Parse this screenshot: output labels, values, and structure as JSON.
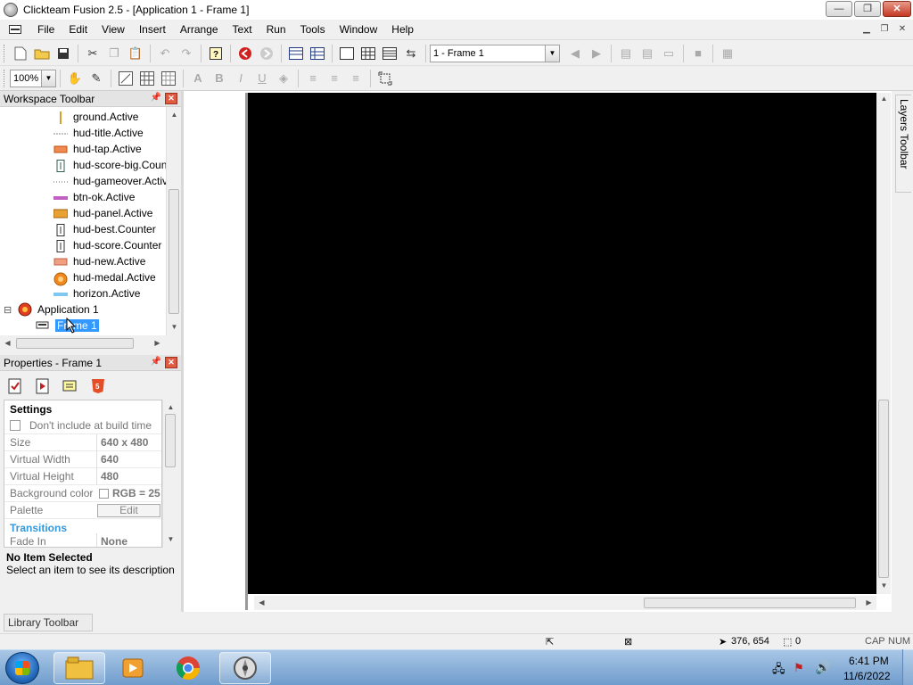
{
  "window": {
    "title": "Clickteam Fusion 2.5 - [Application 1 - Frame 1]",
    "minimize": "—",
    "restore": "❐",
    "close": "✕"
  },
  "menu": [
    "File",
    "Edit",
    "View",
    "Insert",
    "Arrange",
    "Text",
    "Run",
    "Tools",
    "Window",
    "Help"
  ],
  "toolbar": {
    "frame_select": "1 - Frame 1",
    "zoom": "100%",
    "bold": "B",
    "italic": "I",
    "underline": "U"
  },
  "workspace": {
    "title": "Workspace Toolbar",
    "objects": [
      {
        "label": "ground.Active",
        "icon": "ground-icon"
      },
      {
        "label": "hud-title.Active",
        "icon": "hud-title-icon"
      },
      {
        "label": "hud-tap.Active",
        "icon": "hud-tap-icon"
      },
      {
        "label": "hud-score-big.Counter",
        "icon": "counter-icon"
      },
      {
        "label": "hud-gameover.Active",
        "icon": "hud-gameover-icon"
      },
      {
        "label": "btn-ok.Active",
        "icon": "btn-ok-icon"
      },
      {
        "label": "hud-panel.Active",
        "icon": "hud-panel-icon"
      },
      {
        "label": "hud-best.Counter",
        "icon": "counter-icon"
      },
      {
        "label": "hud-score.Counter",
        "icon": "counter-icon"
      },
      {
        "label": "hud-new.Active",
        "icon": "hud-new-icon"
      },
      {
        "label": "hud-medal.Active",
        "icon": "hud-medal-icon"
      },
      {
        "label": "horizon.Active",
        "icon": "horizon-icon"
      }
    ],
    "application": "Application 1",
    "frame": "Frame 1",
    "expand_symbol": "⊟"
  },
  "properties": {
    "title": "Properties - Frame 1",
    "section": "Settings",
    "build_checkbox_label": "Don't include at build time",
    "rows": [
      {
        "name": "Size",
        "value": "640 x 480"
      },
      {
        "name": "Virtual Width",
        "value": "640"
      },
      {
        "name": "Virtual Height",
        "value": "480"
      },
      {
        "name": "Background color",
        "value": "RGB = 25"
      },
      {
        "name": "Palette",
        "value": "Edit"
      }
    ],
    "transitions_header": "Transitions",
    "fade_in": {
      "name": "Fade In",
      "value": "None"
    },
    "desc_title": "No Item Selected",
    "desc_text": "Select an item to see its description"
  },
  "layers_tab": "Layers Toolbar",
  "library_tab": "Library Toolbar",
  "status": {
    "coords": "376, 654",
    "count": "0",
    "cap": "CAP",
    "num": "NUM"
  },
  "taskbar": {
    "time": "6:41 PM",
    "date": "11/6/2022"
  },
  "colors": {
    "frame_background": "#000000",
    "selection": "#3399ff",
    "close_red": "#c43a24"
  }
}
